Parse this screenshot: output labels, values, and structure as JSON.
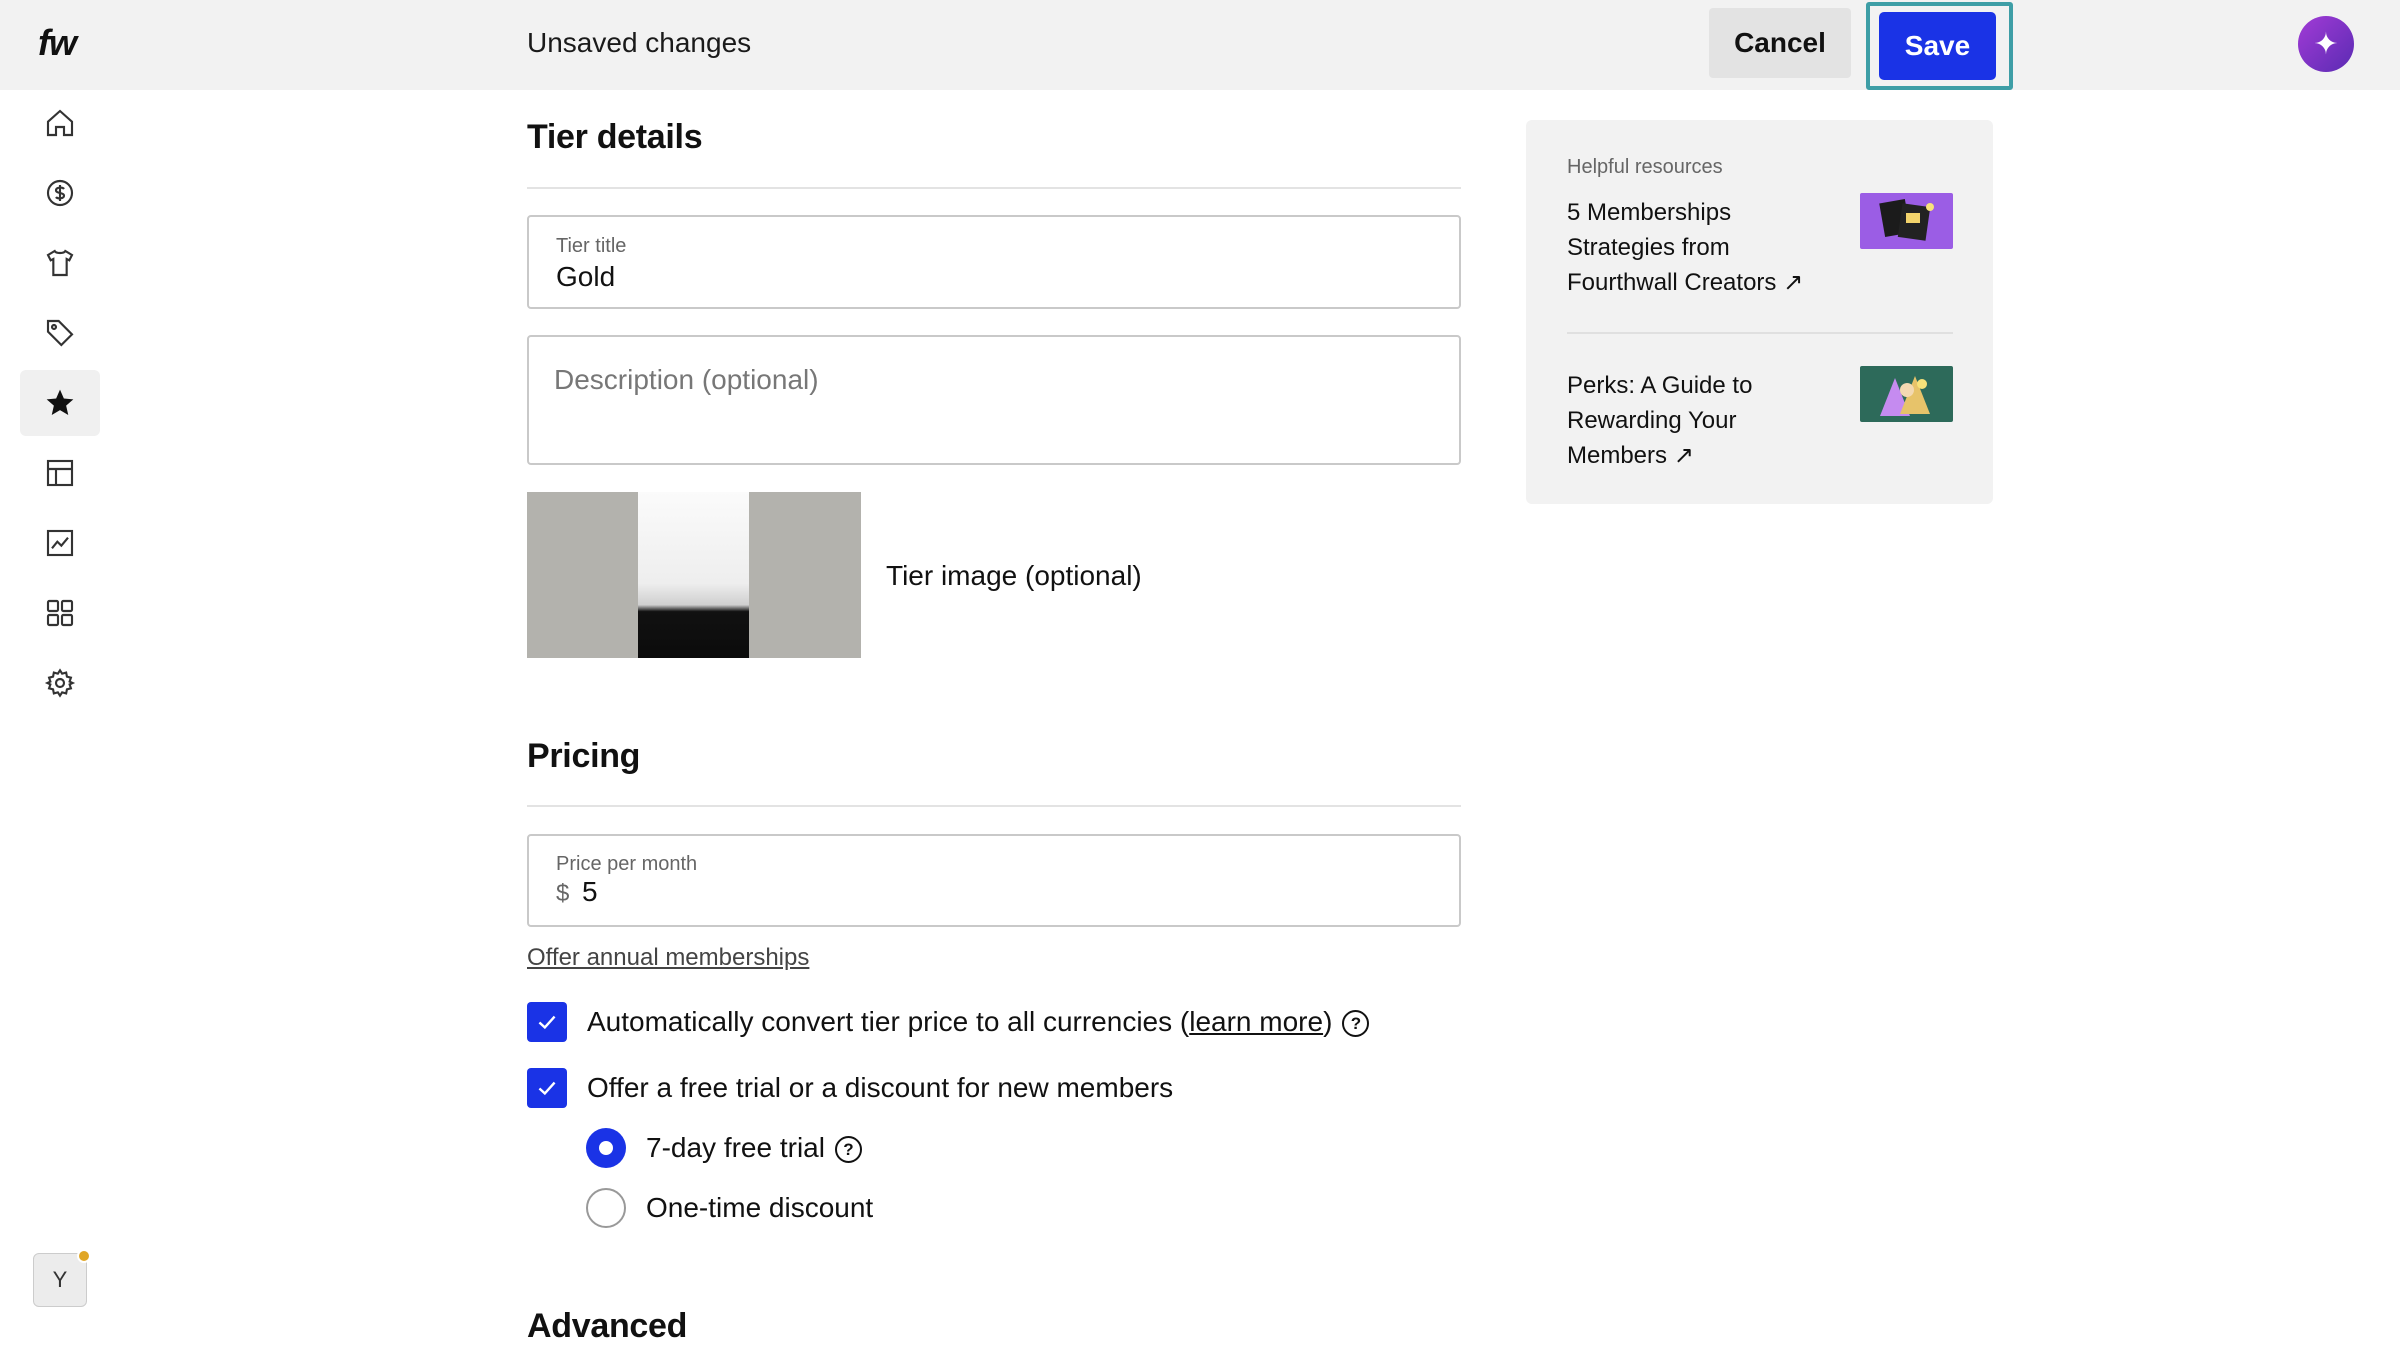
{
  "app": {
    "logo": "fw"
  },
  "header": {
    "status": "Unsaved changes",
    "cancel_label": "Cancel",
    "save_label": "Save"
  },
  "sidebar": {
    "items": [
      {
        "name": "home-icon"
      },
      {
        "name": "dollar-icon"
      },
      {
        "name": "tshirt-icon"
      },
      {
        "name": "tag-icon"
      },
      {
        "name": "star-icon",
        "active": true
      },
      {
        "name": "table-icon"
      },
      {
        "name": "chart-icon"
      },
      {
        "name": "apps-icon"
      },
      {
        "name": "gear-icon"
      }
    ],
    "avatar_initial": "Y"
  },
  "tier_details": {
    "title": "Tier details",
    "tier_title_label": "Tier title",
    "tier_title_value": "Gold",
    "description_placeholder": "Description (optional)",
    "tier_image_label": "Tier image (optional)"
  },
  "pricing": {
    "title": "Pricing",
    "price_label": "Price per month",
    "currency_symbol": "$",
    "price_value": "5",
    "annual_link": "Offer annual memberships",
    "auto_convert_label_pre": "Automatically convert tier price to all currencies (",
    "learn_more": "learn more",
    "auto_convert_label_post": ")",
    "auto_convert_checked": true,
    "free_trial_label": "Offer a free trial or a discount for new members",
    "free_trial_checked": true,
    "options": [
      {
        "label": "7-day free trial",
        "selected": true
      },
      {
        "label": "One-time discount",
        "selected": false
      }
    ]
  },
  "advanced": {
    "title": "Advanced"
  },
  "resources": {
    "heading": "Helpful resources",
    "items": [
      {
        "title": "5 Memberships Strategies from Fourthwall Creators ↗"
      },
      {
        "title": "Perks: A Guide to Rewarding Your Members ↗"
      }
    ]
  },
  "colors": {
    "accent": "#1a33e6",
    "highlight": "#3e9ea6"
  }
}
